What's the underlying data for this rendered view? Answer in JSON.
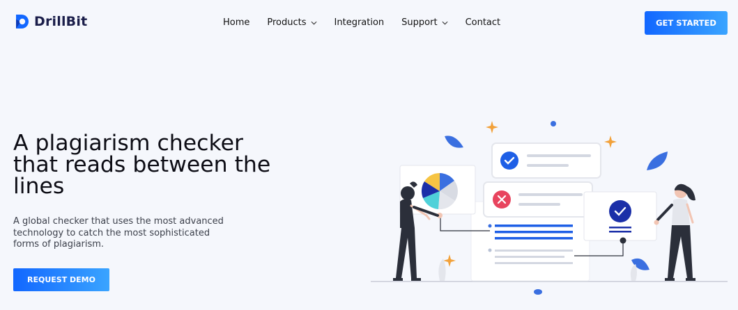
{
  "brand": {
    "name": "DrillBit"
  },
  "nav": {
    "items": [
      {
        "label": "Home",
        "has_dropdown": false
      },
      {
        "label": "Products",
        "has_dropdown": true
      },
      {
        "label": "Integration",
        "has_dropdown": false
      },
      {
        "label": "Support",
        "has_dropdown": true
      },
      {
        "label": "Contact",
        "has_dropdown": false
      }
    ],
    "cta_label": "GET STARTED"
  },
  "hero": {
    "title_line1": "A plagiarism checker",
    "title_line2": "that reads between the",
    "title_line3": "lines",
    "subtitle_line1": "A global checker that uses the most advanced",
    "subtitle_line2": "technology to catch the most sophisticated",
    "subtitle_line3": "forms of plagiarism.",
    "button_label": "REQUEST DEMO"
  },
  "colors": {
    "accent": "#1267ff",
    "accent_light": "#3aa4ff",
    "background": "#f5f7fc",
    "brand_text": "#1b1e4a",
    "error": "#e8445e",
    "highlight_star": "#f2a13a"
  },
  "icons": [
    "logo-d-icon",
    "chevron-down-icon",
    "check-icon",
    "close-icon"
  ]
}
